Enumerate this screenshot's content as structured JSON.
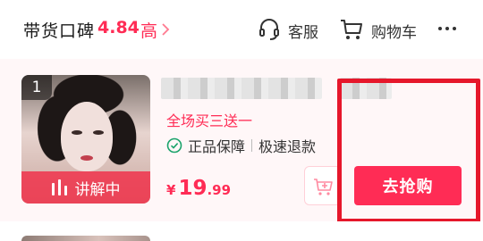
{
  "header": {
    "title": "带货口碑",
    "score": "4.84",
    "level": "高",
    "service_label": "客服",
    "cart_label": "购物车",
    "icons": {
      "chevron": "chevron-right-icon",
      "service": "headset-icon",
      "cart": "cart-icon",
      "more": "more-icon"
    }
  },
  "product": {
    "index": "1",
    "live_label": "讲解中",
    "promo": "全场买三送一",
    "guarantees": [
      "正品保障",
      "极速退款"
    ],
    "price": {
      "symbol": "¥",
      "integer": "19",
      "decimal": ".99"
    },
    "buy_label": "去抢购"
  },
  "colors": {
    "accent": "#ff2c55",
    "highlight_border": "#e6172b",
    "card_bg": "#fff7f8"
  }
}
